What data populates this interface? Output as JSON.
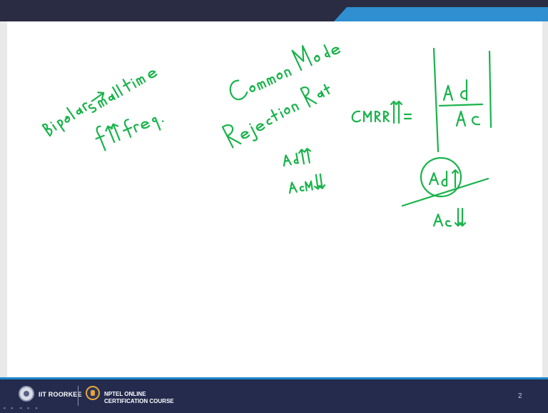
{
  "slide": {
    "page_number": "2"
  },
  "footer": {
    "institute": "IIT ROORKEE",
    "course_line1": "NPTEL ONLINE",
    "course_line2": "CERTIFICATION COURSE",
    "nav_icons": "◂ ▸ ◂ ▸ ▸"
  },
  "colors": {
    "ink": "#19b34b",
    "header": "#2a2c43",
    "header_accent": "#2f8fd0",
    "footer": "#242b4d"
  }
}
